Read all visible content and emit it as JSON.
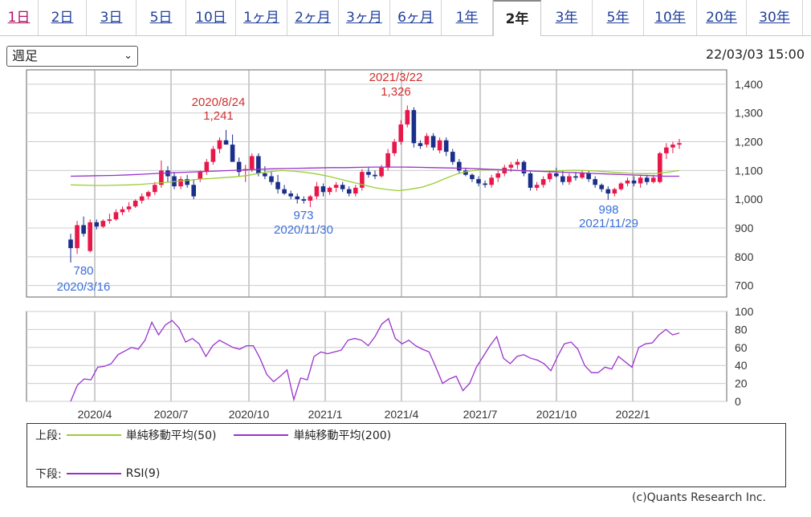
{
  "tabs": [
    "1日",
    "2日",
    "3日",
    "5日",
    "10日",
    "1ヶ月",
    "2ヶ月",
    "3ヶ月",
    "6ヶ月",
    "1年",
    "2年",
    "3年",
    "5年",
    "10年",
    "20年",
    "30年"
  ],
  "active_tab": "2年",
  "period_select": {
    "value": "週足"
  },
  "timestamp": "22/03/03 15:00",
  "legend": {
    "upper_label": "上段:",
    "ma50_label": "単純移動平均(50)",
    "ma200_label": "単純移動平均(200)",
    "lower_label": "下段:",
    "rsi_label": "RSI(9)"
  },
  "copyright": "(c)Quants Research Inc.",
  "colors": {
    "up": "#e8174a",
    "down": "#1a2f8a",
    "ma50": "#9acd32",
    "ma200": "#9932cc",
    "rsi": "#9932cc",
    "annot_high": "#d03030",
    "annot_low": "#3a6fd8"
  },
  "chart_data": [
    {
      "type": "candlestick",
      "title": "",
      "x_tick_labels": [
        "2020/4",
        "2020/7",
        "2020/10",
        "2021/1",
        "2021/4",
        "2021/7",
        "2021/10",
        "2022/1"
      ],
      "y_tick_labels": [
        "1,400",
        "1,300",
        "1,200",
        "1,100",
        "1,000",
        "900",
        "800",
        "700"
      ],
      "ylim": [
        660,
        1450
      ],
      "grid": true,
      "annotations": [
        {
          "kind": "low",
          "value": "780",
          "date": "2020/3/16"
        },
        {
          "kind": "high",
          "value": "1,241",
          "date": "2020/8/24"
        },
        {
          "kind": "low",
          "value": "973",
          "date": "2020/11/30"
        },
        {
          "kind": "high",
          "value": "1,326",
          "date": "2021/3/22"
        },
        {
          "kind": "low",
          "value": "998",
          "date": "2021/11/29"
        }
      ],
      "candles": [
        {
          "o": 860,
          "h": 880,
          "l": 780,
          "c": 830
        },
        {
          "o": 830,
          "h": 925,
          "l": 810,
          "c": 910
        },
        {
          "o": 910,
          "h": 940,
          "l": 870,
          "c": 880
        },
        {
          "o": 820,
          "h": 930,
          "l": 815,
          "c": 920
        },
        {
          "o": 920,
          "h": 930,
          "l": 895,
          "c": 905
        },
        {
          "o": 905,
          "h": 930,
          "l": 900,
          "c": 925
        },
        {
          "o": 925,
          "h": 950,
          "l": 915,
          "c": 930
        },
        {
          "o": 930,
          "h": 965,
          "l": 925,
          "c": 955
        },
        {
          "o": 955,
          "h": 975,
          "l": 945,
          "c": 965
        },
        {
          "o": 965,
          "h": 990,
          "l": 955,
          "c": 975
        },
        {
          "o": 975,
          "h": 1000,
          "l": 970,
          "c": 995
        },
        {
          "o": 995,
          "h": 1020,
          "l": 985,
          "c": 1010
        },
        {
          "o": 1010,
          "h": 1030,
          "l": 1000,
          "c": 1025
        },
        {
          "o": 1025,
          "h": 1060,
          "l": 1015,
          "c": 1050
        },
        {
          "o": 1050,
          "h": 1135,
          "l": 1040,
          "c": 1100
        },
        {
          "o": 1100,
          "h": 1115,
          "l": 1060,
          "c": 1080
        },
        {
          "o": 1080,
          "h": 1095,
          "l": 1035,
          "c": 1045
        },
        {
          "o": 1045,
          "h": 1080,
          "l": 1035,
          "c": 1070
        },
        {
          "o": 1070,
          "h": 1085,
          "l": 1040,
          "c": 1050
        },
        {
          "o": 1050,
          "h": 1070,
          "l": 1000,
          "c": 1010
        },
        {
          "o": 1070,
          "h": 1100,
          "l": 1060,
          "c": 1095
        },
        {
          "o": 1095,
          "h": 1140,
          "l": 1085,
          "c": 1130
        },
        {
          "o": 1130,
          "h": 1185,
          "l": 1120,
          "c": 1175
        },
        {
          "o": 1175,
          "h": 1215,
          "l": 1160,
          "c": 1205
        },
        {
          "o": 1205,
          "h": 1241,
          "l": 1195,
          "c": 1190
        },
        {
          "o": 1190,
          "h": 1225,
          "l": 1160,
          "c": 1130
        },
        {
          "o": 1130,
          "h": 1145,
          "l": 1080,
          "c": 1095
        },
        {
          "o": 1100,
          "h": 1120,
          "l": 1060,
          "c": 1105
        },
        {
          "o": 1105,
          "h": 1160,
          "l": 1095,
          "c": 1150
        },
        {
          "o": 1150,
          "h": 1160,
          "l": 1080,
          "c": 1090
        },
        {
          "o": 1090,
          "h": 1115,
          "l": 1070,
          "c": 1080
        },
        {
          "o": 1080,
          "h": 1095,
          "l": 1050,
          "c": 1060
        },
        {
          "o": 1060,
          "h": 1085,
          "l": 1020,
          "c": 1035
        },
        {
          "o": 1035,
          "h": 1050,
          "l": 1015,
          "c": 1020
        },
        {
          "o": 1020,
          "h": 1030,
          "l": 1000,
          "c": 1010
        },
        {
          "o": 1010,
          "h": 1020,
          "l": 985,
          "c": 1000
        },
        {
          "o": 1000,
          "h": 1010,
          "l": 985,
          "c": 995
        },
        {
          "o": 995,
          "h": 1015,
          "l": 973,
          "c": 1010
        },
        {
          "o": 1010,
          "h": 1060,
          "l": 1000,
          "c": 1045
        },
        {
          "o": 1045,
          "h": 1055,
          "l": 1010,
          "c": 1025
        },
        {
          "o": 1025,
          "h": 1045,
          "l": 1015,
          "c": 1040
        },
        {
          "o": 1040,
          "h": 1060,
          "l": 1025,
          "c": 1050
        },
        {
          "o": 1050,
          "h": 1060,
          "l": 1025,
          "c": 1035
        },
        {
          "o": 1035,
          "h": 1045,
          "l": 1010,
          "c": 1020
        },
        {
          "o": 1020,
          "h": 1050,
          "l": 1010,
          "c": 1040
        },
        {
          "o": 1040,
          "h": 1105,
          "l": 1030,
          "c": 1095
        },
        {
          "o": 1095,
          "h": 1110,
          "l": 1075,
          "c": 1085
        },
        {
          "o": 1085,
          "h": 1100,
          "l": 1070,
          "c": 1080
        },
        {
          "o": 1080,
          "h": 1120,
          "l": 1075,
          "c": 1110
        },
        {
          "o": 1110,
          "h": 1175,
          "l": 1100,
          "c": 1160
        },
        {
          "o": 1160,
          "h": 1210,
          "l": 1150,
          "c": 1200
        },
        {
          "o": 1200,
          "h": 1275,
          "l": 1190,
          "c": 1260
        },
        {
          "o": 1260,
          "h": 1326,
          "l": 1250,
          "c": 1310
        },
        {
          "o": 1310,
          "h": 1320,
          "l": 1180,
          "c": 1195
        },
        {
          "o": 1195,
          "h": 1205,
          "l": 1175,
          "c": 1185
        },
        {
          "o": 1190,
          "h": 1230,
          "l": 1180,
          "c": 1220
        },
        {
          "o": 1220,
          "h": 1230,
          "l": 1170,
          "c": 1180
        },
        {
          "o": 1170,
          "h": 1215,
          "l": 1160,
          "c": 1205
        },
        {
          "o": 1205,
          "h": 1215,
          "l": 1150,
          "c": 1165
        },
        {
          "o": 1165,
          "h": 1175,
          "l": 1120,
          "c": 1130
        },
        {
          "o": 1130,
          "h": 1140,
          "l": 1090,
          "c": 1100
        },
        {
          "o": 1100,
          "h": 1110,
          "l": 1080,
          "c": 1085
        },
        {
          "o": 1085,
          "h": 1090,
          "l": 1060,
          "c": 1070
        },
        {
          "o": 1070,
          "h": 1080,
          "l": 1045,
          "c": 1055
        },
        {
          "o": 1055,
          "h": 1065,
          "l": 1040,
          "c": 1050
        },
        {
          "o": 1050,
          "h": 1085,
          "l": 1040,
          "c": 1075
        },
        {
          "o": 1075,
          "h": 1100,
          "l": 1060,
          "c": 1090
        },
        {
          "o": 1090,
          "h": 1120,
          "l": 1080,
          "c": 1110
        },
        {
          "o": 1110,
          "h": 1130,
          "l": 1095,
          "c": 1120
        },
        {
          "o": 1120,
          "h": 1140,
          "l": 1105,
          "c": 1130
        },
        {
          "o": 1130,
          "h": 1135,
          "l": 1080,
          "c": 1090
        },
        {
          "o": 1090,
          "h": 1100,
          "l": 1030,
          "c": 1040
        },
        {
          "o": 1040,
          "h": 1060,
          "l": 1030,
          "c": 1050
        },
        {
          "o": 1050,
          "h": 1080,
          "l": 1040,
          "c": 1070
        },
        {
          "o": 1070,
          "h": 1100,
          "l": 1060,
          "c": 1090
        },
        {
          "o": 1090,
          "h": 1110,
          "l": 1075,
          "c": 1080
        },
        {
          "o": 1080,
          "h": 1100,
          "l": 1050,
          "c": 1060
        },
        {
          "o": 1060,
          "h": 1090,
          "l": 1050,
          "c": 1080
        },
        {
          "o": 1080,
          "h": 1095,
          "l": 1065,
          "c": 1075
        },
        {
          "o": 1075,
          "h": 1100,
          "l": 1070,
          "c": 1090
        },
        {
          "o": 1090,
          "h": 1100,
          "l": 1060,
          "c": 1070
        },
        {
          "o": 1070,
          "h": 1080,
          "l": 1040,
          "c": 1050
        },
        {
          "o": 1050,
          "h": 1055,
          "l": 1025,
          "c": 1035
        },
        {
          "o": 1035,
          "h": 1045,
          "l": 998,
          "c": 1020
        },
        {
          "o": 1020,
          "h": 1040,
          "l": 1010,
          "c": 1035
        },
        {
          "o": 1035,
          "h": 1060,
          "l": 1030,
          "c": 1055
        },
        {
          "o": 1055,
          "h": 1075,
          "l": 1045,
          "c": 1065
        },
        {
          "o": 1065,
          "h": 1080,
          "l": 1045,
          "c": 1055
        },
        {
          "o": 1055,
          "h": 1085,
          "l": 1040,
          "c": 1075
        },
        {
          "o": 1075,
          "h": 1085,
          "l": 1050,
          "c": 1060
        },
        {
          "o": 1060,
          "h": 1085,
          "l": 1055,
          "c": 1075
        },
        {
          "o": 1060,
          "h": 1165,
          "l": 1055,
          "c": 1160
        },
        {
          "o": 1160,
          "h": 1195,
          "l": 1140,
          "c": 1180
        },
        {
          "o": 1180,
          "h": 1200,
          "l": 1160,
          "c": 1190
        },
        {
          "o": 1190,
          "h": 1210,
          "l": 1175,
          "c": 1195
        }
      ],
      "series": [
        {
          "name": "単純移動平均(50)",
          "values": [
            1050,
            1049,
            1048,
            1048,
            1049,
            1050,
            1052,
            1055,
            1058,
            1062,
            1066,
            1070,
            1072,
            1075,
            1078,
            1082,
            1090,
            1096,
            1100,
            1098,
            1094,
            1088,
            1080,
            1070,
            1060,
            1050,
            1040,
            1034,
            1030,
            1035,
            1042,
            1055,
            1072,
            1088,
            1098,
            1102,
            1103,
            1102,
            1100,
            1098,
            1097,
            1098,
            1100,
            1101,
            1100,
            1098,
            1095,
            1092,
            1090,
            1089,
            1090,
            1094,
            1100
          ]
        },
        {
          "name": "単純移動平均(200)",
          "values": [
            1080,
            1081,
            1082,
            1083,
            1085,
            1087,
            1090,
            1092,
            1094,
            1096,
            1098,
            1100,
            1102,
            1104,
            1106,
            1107,
            1108,
            1109,
            1110,
            1110,
            1111,
            1112,
            1112,
            1112,
            1111,
            1110,
            1109,
            1108,
            1106,
            1104,
            1102,
            1100,
            1098,
            1096,
            1094,
            1092,
            1090,
            1088,
            1086,
            1084,
            1082,
            1080,
            1080
          ]
        }
      ]
    },
    {
      "type": "line",
      "title": "",
      "ylim": [
        0,
        100
      ],
      "y_tick_labels": [
        "100",
        "80",
        "60",
        "40",
        "20",
        "0"
      ],
      "series": [
        {
          "name": "RSI(9)",
          "values": [
            0,
            18,
            25,
            24,
            38,
            39,
            42,
            52,
            56,
            60,
            58,
            68,
            88,
            74,
            85,
            90,
            82,
            66,
            70,
            64,
            50,
            62,
            68,
            64,
            60,
            58,
            62,
            62,
            48,
            30,
            22,
            28,
            35,
            2,
            26,
            24,
            50,
            55,
            53,
            55,
            57,
            68,
            70,
            68,
            62,
            72,
            86,
            92,
            70,
            64,
            68,
            62,
            58,
            55,
            38,
            20,
            25,
            28,
            12,
            20,
            38,
            50,
            62,
            72,
            48,
            42,
            50,
            52,
            48,
            46,
            42,
            34,
            50,
            64,
            66,
            58,
            40,
            32,
            32,
            38,
            36,
            50,
            44,
            38,
            60,
            64,
            65,
            74,
            80,
            74,
            76
          ]
        }
      ]
    }
  ]
}
